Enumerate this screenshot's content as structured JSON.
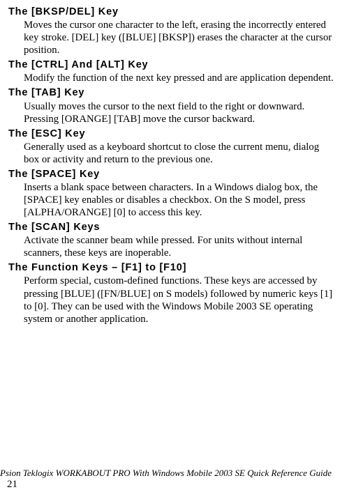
{
  "entries": [
    {
      "term": "The [BKSP/DEL] Key",
      "desc": "Moves the cursor one character to the left, erasing the incorrectly entered key stroke. [DEL] key ([BLUE] [BKSP]) erases the character at the cursor position."
    },
    {
      "term": "The [CTRL] And [ALT] Key",
      "desc": "Modify the function of the next key pressed and are application dependent."
    },
    {
      "term": "The [TAB] Key",
      "desc": "Usually moves the cursor to the next field to the right or downward. Pressing [ORANGE] [TAB] move the cursor backward."
    },
    {
      "term": "The [ESC] Key",
      "desc": "Generally used as a keyboard shortcut to close the current menu, dialog box or activity and return to the previous one."
    },
    {
      "term": "The [SPACE] Key",
      "desc": "Inserts a blank space between characters. In a Windows dialog box, the [SPACE] key enables or disables a checkbox. On the S model, press [ALPHA/ORANGE] [0] to access this key."
    },
    {
      "term": "The [SCAN] Keys",
      "desc": "Activate the scanner beam while pressed. For units without internal scanners, these keys are inoperable."
    },
    {
      "term": "The Function Keys – [F1] to [F10]",
      "desc": "Perform special, custom-defined functions. These keys are accessed by pressing [BLUE] ([FN/BLUE] on S models) followed by numeric keys [1] to [0]. They can be used with the Windows Mobile 2003 SE operating system or another application."
    }
  ],
  "footer": {
    "title": "Psion Teklogix WORKABOUT PRO With Windows Mobile 2003 SE Quick Reference Guide",
    "page": "21"
  }
}
